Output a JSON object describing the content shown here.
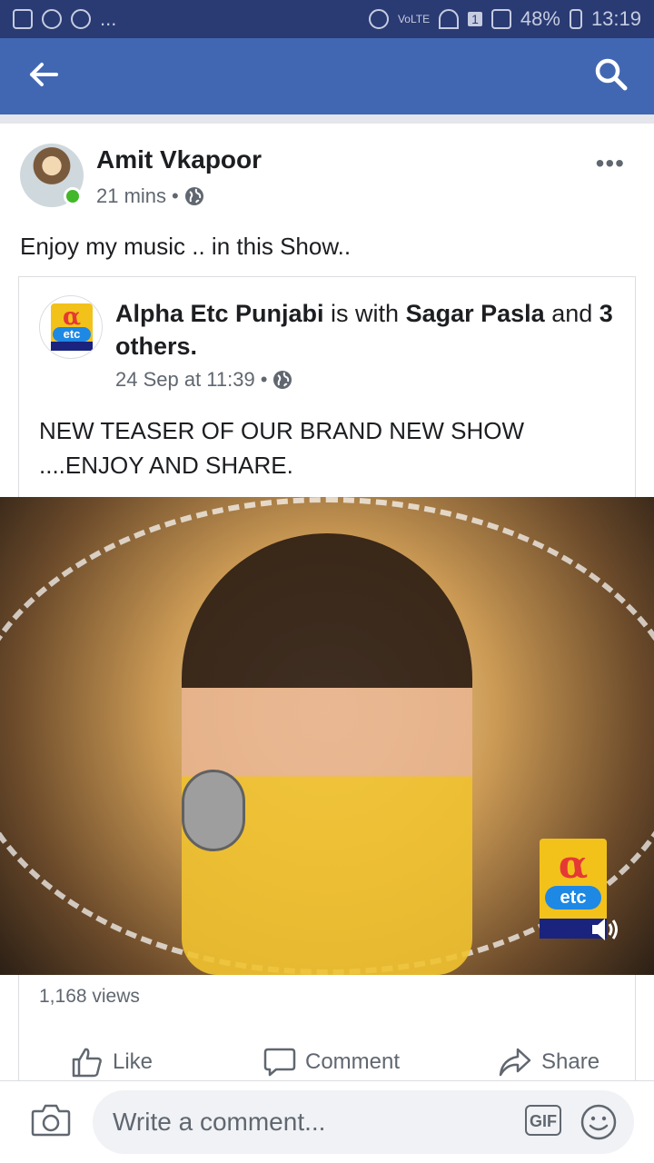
{
  "status_bar": {
    "left_dots": "...",
    "network": "VoLTE",
    "sim_badge": "1",
    "battery": "48%",
    "time": "13:19"
  },
  "top_bar": {
    "back_icon": "arrow-left-icon",
    "search_icon": "search-icon"
  },
  "post": {
    "author": "Amit Vkapoor",
    "time": "21 mins",
    "privacy_icon": "globe-icon",
    "text": "Enjoy my music .. in this Show..",
    "more_label": "•••"
  },
  "shared_post": {
    "page_name": "Alpha Etc Punjabi",
    "with_text": "is with",
    "tagged_name": "Sagar Pasla",
    "and_text": "and",
    "others_text": "3 others.",
    "date": "24 Sep at 11:39",
    "privacy_icon": "globe-icon",
    "text": "NEW TEASER OF OUR BRAND NEW SHOW ....ENJOY AND SHARE.",
    "logo": {
      "alpha": "α",
      "etc": "etc"
    },
    "video": {
      "sound_icon": "volume-icon"
    },
    "views": "1,168 views"
  },
  "actions": {
    "like": "Like",
    "comment": "Comment",
    "share": "Share"
  },
  "composer": {
    "placeholder": "Write a comment...",
    "gif_label": "GIF",
    "camera_icon": "camera-icon",
    "emoji_icon": "emoji-icon"
  },
  "colors": {
    "status_bar": "#2a3a73",
    "top_bar": "#4267b2",
    "online": "#42b72a"
  }
}
